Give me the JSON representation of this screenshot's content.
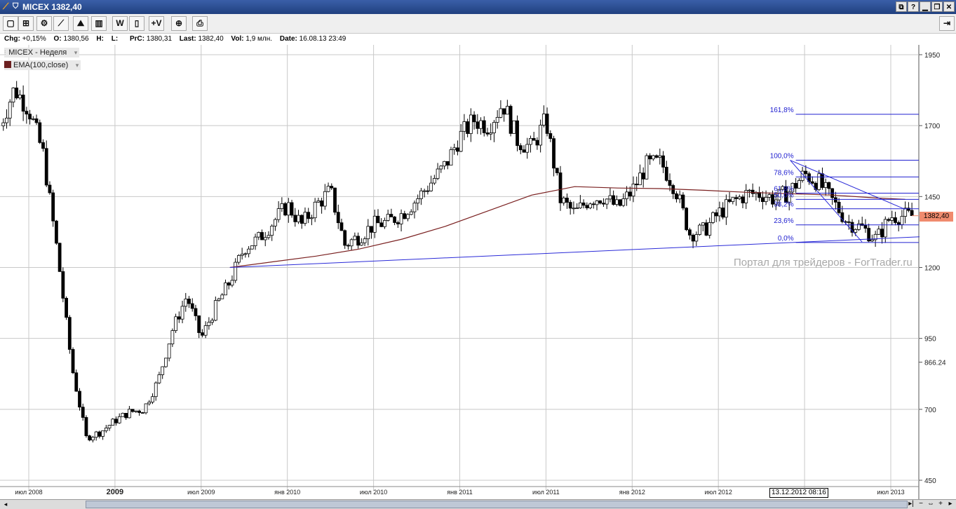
{
  "window": {
    "title": "MICEX 1382,40",
    "buttons": [
      "⧉",
      "?",
      "▁",
      "❐",
      "✕"
    ]
  },
  "toolbar": {
    "buttons": [
      {
        "name": "new-chart-button",
        "glyph": "▢"
      },
      {
        "name": "add-indicator-button",
        "glyph": "⊞"
      },
      {
        "name": "settings-button",
        "glyph": "⚙"
      },
      {
        "name": "draw-line-button",
        "glyph": "⟋"
      },
      {
        "name": "indicator-chart-button",
        "glyph": "⛰"
      },
      {
        "name": "bar-chart-button",
        "glyph": "▥"
      },
      {
        "name": "weekly-button",
        "glyph": "W"
      },
      {
        "name": "candle-button",
        "glyph": "▯"
      },
      {
        "name": "volume-button",
        "glyph": "+V"
      },
      {
        "name": "crosshair-button",
        "glyph": "⊕"
      },
      {
        "name": "print-button",
        "glyph": "⎙"
      }
    ],
    "right_button_glyph": "⇥"
  },
  "info": {
    "chg_label": "Chg:",
    "chg": "+0,15%",
    "o_label": "O:",
    "o": "1380,56",
    "h_label": "H:",
    "h": "",
    "l_label": "L:",
    "l": "",
    "prc_label": "PrC:",
    "prc": "1380,31",
    "last_label": "Last:",
    "last": "1382,40",
    "vol_label": "Vol:",
    "vol": "1,9 млн.",
    "date_label": "Date:",
    "date": "16.08.13 23:49"
  },
  "legend": {
    "main": "MICEX - Неделя",
    "ema": "EMA(100,close)",
    "ema_color": "#6b1f1f"
  },
  "watermark": "Портал для трейдеров - ForTrader.ru",
  "crosshair_date": "13.12.2012 08:16",
  "current_price": "1382,40",
  "colors": {
    "candle": "#000000",
    "grid": "#c8c8c8",
    "ema": "#7a2020",
    "fib": "#2020d0",
    "trend": "#2a2ad8",
    "price_tag": "#f08b6e"
  },
  "chart_data": {
    "type": "candlestick",
    "timeframe": "Неделя",
    "symbol": "MICEX",
    "y_ticks": [
      1950,
      1700,
      1450,
      1200,
      950,
      700,
      450
    ],
    "y_extra_label": "866.24",
    "ylim": [
      450,
      1950
    ],
    "x_ticks": [
      "июл 2008",
      "2009",
      "июл 2009",
      "янв 2010",
      "июл 2010",
      "янв 2011",
      "июл 2011",
      "янв 2012",
      "июл 2012",
      "янв 2013",
      "июл 2013"
    ],
    "x_range": [
      "2008-05",
      "2013-09"
    ],
    "close_path": [
      [
        "2008-05",
        1700
      ],
      [
        "2008-06",
        1830
      ],
      [
        "2008-07",
        1760
      ],
      [
        "2008-08",
        1600
      ],
      [
        "2008-09",
        1250
      ],
      [
        "2008-10",
        850
      ],
      [
        "2008-11",
        600
      ],
      [
        "2008-12",
        620
      ],
      [
        "2009-01",
        660
      ],
      [
        "2009-02",
        690
      ],
      [
        "2009-03",
        700
      ],
      [
        "2009-04",
        800
      ],
      [
        "2009-05",
        980
      ],
      [
        "2009-06",
        1100
      ],
      [
        "2009-07",
        950
      ],
      [
        "2009-08",
        1060
      ],
      [
        "2009-09",
        1150
      ],
      [
        "2009-10",
        1270
      ],
      [
        "2009-11",
        1300
      ],
      [
        "2009-12",
        1360
      ],
      [
        "2010-01",
        1420
      ],
      [
        "2010-02",
        1350
      ],
      [
        "2010-03",
        1420
      ],
      [
        "2010-04",
        1470
      ],
      [
        "2010-05",
        1280
      ],
      [
        "2010-06",
        1310
      ],
      [
        "2010-07",
        1350
      ],
      [
        "2010-08",
        1360
      ],
      [
        "2010-09",
        1390
      ],
      [
        "2010-10",
        1440
      ],
      [
        "2010-11",
        1500
      ],
      [
        "2010-12",
        1560
      ],
      [
        "2011-01",
        1660
      ],
      [
        "2011-02",
        1720
      ],
      [
        "2011-03",
        1700
      ],
      [
        "2011-04",
        1780
      ],
      [
        "2011-05",
        1650
      ],
      [
        "2011-06",
        1620
      ],
      [
        "2011-07",
        1720
      ],
      [
        "2011-08",
        1440
      ],
      [
        "2011-09",
        1390
      ],
      [
        "2011-10",
        1440
      ],
      [
        "2011-11",
        1450
      ],
      [
        "2011-12",
        1410
      ],
      [
        "2012-01",
        1470
      ],
      [
        "2012-02",
        1560
      ],
      [
        "2012-03",
        1570
      ],
      [
        "2012-04",
        1480
      ],
      [
        "2012-05",
        1320
      ],
      [
        "2012-06",
        1330
      ],
      [
        "2012-07",
        1390
      ],
      [
        "2012-08",
        1430
      ],
      [
        "2012-09",
        1460
      ],
      [
        "2012-10",
        1460
      ],
      [
        "2012-11",
        1440
      ],
      [
        "2012-12",
        1470
      ],
      [
        "2013-01",
        1530
      ],
      [
        "2013-02",
        1500
      ],
      [
        "2013-03",
        1430
      ],
      [
        "2013-04",
        1360
      ],
      [
        "2013-05",
        1340
      ],
      [
        "2013-06",
        1300
      ],
      [
        "2013-07",
        1380
      ],
      [
        "2013-08",
        1382
      ]
    ],
    "ema_100": [
      [
        "2009-09",
        1200
      ],
      [
        "2009-12",
        1220
      ],
      [
        "2010-03",
        1240
      ],
      [
        "2010-06",
        1265
      ],
      [
        "2010-09",
        1300
      ],
      [
        "2010-12",
        1345
      ],
      [
        "2011-03",
        1400
      ],
      [
        "2011-06",
        1455
      ],
      [
        "2011-09",
        1485
      ],
      [
        "2011-12",
        1480
      ],
      [
        "2012-03",
        1478
      ],
      [
        "2012-06",
        1472
      ],
      [
        "2012-09",
        1465
      ],
      [
        "2012-12",
        1460
      ],
      [
        "2013-03",
        1455
      ],
      [
        "2013-06",
        1445
      ],
      [
        "2013-08",
        1440
      ]
    ],
    "fibonacci": {
      "levels": [
        "161,8%",
        "100,0%",
        "78,6%",
        "61,8%",
        "50,0%",
        "38,2%",
        "23,6%",
        "0,0%"
      ],
      "prices": [
        1740,
        1578,
        1519,
        1462,
        1440,
        1407,
        1350,
        1288
      ]
    },
    "trendlines": [
      {
        "from": [
          "2009-09",
          1200
        ],
        "to": [
          "2013-09",
          1308
        ]
      },
      {
        "from": [
          "2012-12",
          1578
        ],
        "to": [
          "2013-05",
          1290
        ]
      },
      {
        "from": [
          "2012-12",
          1578
        ],
        "to": [
          "2013-08",
          1405
        ]
      }
    ]
  }
}
